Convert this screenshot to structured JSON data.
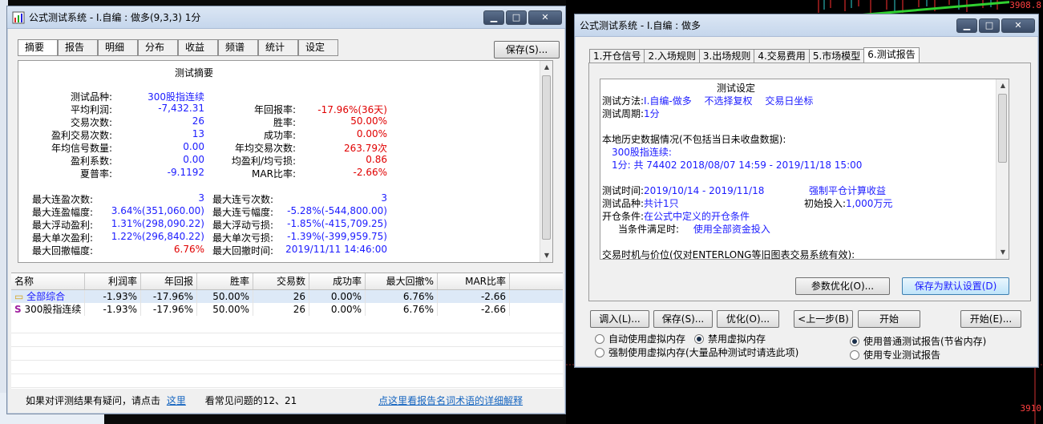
{
  "win1": {
    "title": "公式测试系统 - I.自编 : 做多(9,3,3) 1分",
    "tabs": [
      "摘要",
      "报告",
      "明细",
      "分布",
      "收益",
      "频谱",
      "统计",
      "设定"
    ],
    "save_btn": "保存(S)...",
    "summary_title": "测试摘要",
    "summary": {
      "product_label": "测试品种:",
      "product_value": "300股指连续",
      "r1": {
        "l1": "平均利润:",
        "v1": "-7,432.31",
        "l2": "年回报率:",
        "v2": "-17.96%(36天)"
      },
      "r2": {
        "l1": "交易次数:",
        "v1": "26",
        "l2": "胜率:",
        "v2": "50.00%"
      },
      "r3": {
        "l1": "盈利交易次数:",
        "v1": "13",
        "l2": "成功率:",
        "v2": "0.00%"
      },
      "r4": {
        "l1": "年均信号数量:",
        "v1": "0.00",
        "l2": "年均交易次数:",
        "v2": "263.79次"
      },
      "r5": {
        "l1": "盈利系数:",
        "v1": "0.00",
        "l2": "均盈利/均亏损:",
        "v2": "0.86"
      },
      "r6": {
        "l1": "夏普率:",
        "v1": "-9.1192",
        "l2": "MAR比率:",
        "v2": "-2.66%"
      },
      "r7": {
        "l1": "最大连盈次数:",
        "v1": "3",
        "l2": "最大连亏次数:",
        "v2": "3"
      },
      "r8": {
        "l1": "最大连盈幅度:",
        "v1": "3.64%(351,060.00)",
        "l2": "最大连亏幅度:",
        "v2": "-5.28%(-544,800.00)"
      },
      "r9": {
        "l1": "最大浮动盈利:",
        "v1": "1.31%(298,090.22)",
        "l2": "最大浮动亏损:",
        "v2": "-1.85%(-415,709.25)"
      },
      "r10": {
        "l1": "最大单次盈利:",
        "v1": "1.22%(296,840.22)",
        "l2": "最大单次亏损:",
        "v2": "-1.39%(-399,959.75)"
      },
      "r11": {
        "l1": "最大回撤幅度:",
        "v1": "6.76%",
        "l2": "最大回撤时间:",
        "v2": "2019/11/11 14:46:00"
      }
    },
    "grid": {
      "headers": [
        "名称",
        "利润率",
        "年回报",
        "胜率",
        "交易数",
        "成功率",
        "最大回撤%",
        "MAR比率"
      ],
      "rows": [
        {
          "name": "全部综合",
          "c1": "-1.93%",
          "c2": "-17.96%",
          "c3": "50.00%",
          "c4": "26",
          "c5": "0.00%",
          "c6": "6.76%",
          "c7": "-2.66"
        },
        {
          "name": "300股指连续",
          "c1": "-1.93%",
          "c2": "-17.96%",
          "c3": "50.00%",
          "c4": "26",
          "c5": "0.00%",
          "c6": "6.76%",
          "c7": "-2.66"
        }
      ]
    },
    "footer": {
      "q": "如果对评测结果有疑问，请点击",
      "here": "这里",
      "faq": "看常见问题的12、21",
      "detail_link": "点这里看报告名词术语的详细解释"
    }
  },
  "win2": {
    "title": "公式测试系统 - I.自编 : 做多",
    "tabs": [
      "1.开仓信号",
      "2.入场规则",
      "3.出场规则",
      "4.交易费用",
      "5.市场模型",
      "6.测试报告"
    ],
    "report": {
      "heading": "测试设定",
      "method_label": "测试方法:",
      "method_value": "I.自编-做多　 不选择复权　 交易日坐标",
      "period_label": "测试周期:",
      "period_value": "1分",
      "history": "本地历史数据情况(不包括当日未收盘数据):",
      "hist_name": "300股指连续:",
      "hist_detail": "1分: 共 74402 2018/08/07 14:59 - 2019/11/18 15:00",
      "time_label": "测试时间:",
      "time_value": "2019/10/14 - 2019/11/18",
      "force_close": "强制平仓计算收益",
      "prod_label": "测试品种:",
      "prod_value": "共计1只",
      "invest_label": "初始投入:",
      "invest_value": "1,000万元",
      "cond_label": "开仓条件:",
      "cond_value": "在公式中定义的开仓条件",
      "when_label": "当条件满足时:",
      "when_value": "使用全部资金投入",
      "trade_note": "交易时机与价位(仅对ENTERLONG等旧图表交易系统有效):"
    },
    "param_btn": "参数优化(O)...",
    "default_btn": "保存为默认设置(D)",
    "bottom_btns": [
      "调入(L)...",
      "保存(S)...",
      "优化(O)...",
      "<上一步(B)",
      "开始",
      "开始(E)..."
    ],
    "radios": {
      "auto_vm": "自动使用虚拟内存",
      "disable_vm": "禁用虚拟内存",
      "force_vm": "强制使用虚拟内存(大量品种测试时请选此项)",
      "normal_report": "使用普通测试报告(节省内存)",
      "pro_report": "使用专业测试报告"
    }
  },
  "chart": {
    "price_top": "3908.8",
    "price_bottom": "3910"
  }
}
